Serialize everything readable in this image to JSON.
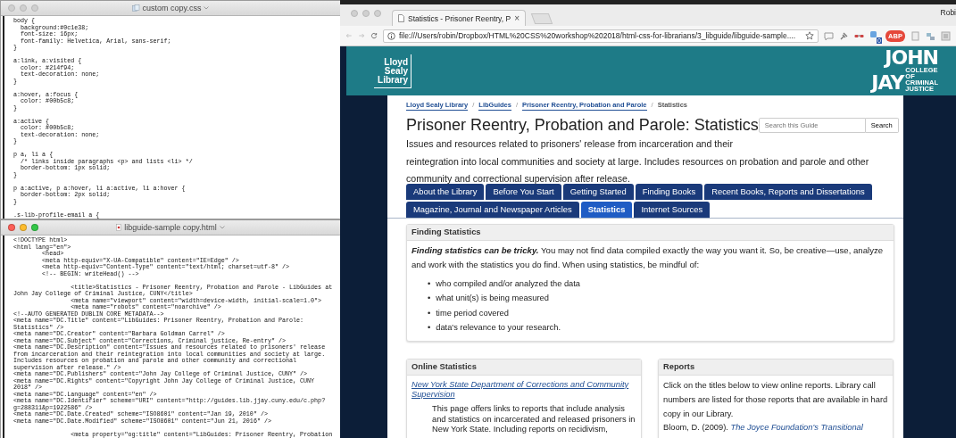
{
  "editors": [
    {
      "title": "custom copy.css",
      "active": false,
      "blocks": [
        [
          "body {",
          "  background:#0c1e38;",
          "  font-size: 16px;",
          "  font-family: Helvetica, Arial, sans-serif;",
          "}"
        ],
        [
          "a:link, a:visited {",
          "  color: #214f94;",
          "  text-decoration: none;",
          "}"
        ],
        [
          "a:hover, a:focus {",
          "  color: #00b5c8;",
          "}"
        ],
        [
          "a:active {",
          "  color: #00b5c8;",
          "  text-decoration: none;",
          "}"
        ],
        [
          "p a, li a {",
          "  /* links inside paragraphs <p> and lists <li> */",
          "  border-bottom: 1px solid;",
          "}"
        ],
        [
          "p a:active, p a:hover, li a:active, li a:hover {",
          "  border-bottom: 2px solid;",
          "}"
        ],
        [
          ".s-lib-profile-email a {"
        ]
      ]
    },
    {
      "title": "libguide-sample copy.html",
      "active": true,
      "blocks": [
        [
          "<!DOCTYPE html>",
          "<html lang=\"en\">",
          "        <head>",
          "        <meta http-equiv=\"X-UA-Compatible\" content=\"IE=Edge\" />",
          "        <meta http-equiv=\"Content-Type\" content=\"text/html; charset=utf-8\" />",
          "        <!-- BEGIN: writeHead() -->"
        ],
        [
          "                <title>Statistics - Prisoner Reentry, Probation and Parole - LibGuides at",
          "John Jay College of Criminal Justice, CUNY</title>",
          "                <meta name=\"viewport\" content=\"width=device-width, initial-scale=1.0\">",
          "                <meta name=\"robots\" content=\"noarchive\" />",
          "<!--AUTO GENERATED DUBLIN CORE METADATA-->",
          "<meta name=\"DC.Title\" content=\"LibGuides: Prisoner Reentry, Probation and Parole:",
          "Statistics\" />",
          "<meta name=\"DC.Creator\" content=\"Barbara Goldman Carrel\" />",
          "<meta name=\"DC.Subject\" content=\"Corrections, Criminal justice, Re-entry\" />",
          "<meta name=\"DC.Description\" content=\"Issues and resources related to prisoners' release",
          "from incarceration and their reintegration into local communities and society at large.",
          "Includes resources on probation and parole and other community and correctional",
          "supervision after release.\" />",
          "<meta name=\"DC.Publishers\" content=\"John Jay College of Criminal Justice, CUNY\" />",
          "<meta name=\"DC.Rights\" content=\"Copyright John Jay College of Criminal Justice, CUNY",
          "2018\" />",
          "<meta name=\"DC.Language\" content=\"en\" />",
          "<meta name=\"DC.Identifier\" scheme=\"URI\" content=\"http://guides.lib.jjay.cuny.edu/c.php?",
          "g=288311&p=1922586\" />",
          "<meta name=\"DC.Date.Created\" scheme=\"ISO8601\" content=\"Jan 19, 2010\" />",
          "<meta name=\"DC.Date.Modified\" scheme=\"ISO8601\" content=\"Jun 21, 2016\" />"
        ],
        [
          "                <meta property=\"og:title\" content=\"LibGuides: Prisoner Reentry, Probation"
        ]
      ]
    }
  ],
  "browser": {
    "tab": {
      "title": "Statistics - Prisoner Reentry, P",
      "close": "×"
    },
    "profile": "Robi",
    "url": "file:///Users/robin/Dropbox/HTML%20CSS%20workshop%202018/html-css-for-librarians/3_libguide/libguide-sample....",
    "extensions": [
      {
        "kind": "bubble"
      },
      {
        "kind": "pin"
      },
      {
        "kind": "glasses"
      },
      {
        "kind": "badge",
        "label": "0"
      },
      {
        "kind": "stop",
        "label": "ABP"
      },
      {
        "kind": "page"
      },
      {
        "kind": "satellite"
      },
      {
        "kind": "panel"
      }
    ]
  },
  "page": {
    "header": {
      "library_logo": [
        "Lloyd",
        "Sealy",
        "Library"
      ],
      "college_logo": {
        "name": [
          "JOHN",
          "JAY"
        ],
        "tagline": [
          "COLLEGE",
          "OF",
          "CRIMINAL",
          "JUSTICE"
        ]
      }
    },
    "breadcrumbs": {
      "separator": "/",
      "items": [
        {
          "label": "Lloyd Sealy Library",
          "link": true
        },
        {
          "label": "LibGuides",
          "link": true
        },
        {
          "label": "Prisoner Reentry, Probation and Parole",
          "link": true
        },
        {
          "label": "Statistics",
          "link": false
        }
      ]
    },
    "title": "Prisoner Reentry, Probation and Parole: Statistics",
    "search": {
      "placeholder": "Search this Guide",
      "button": "Search"
    },
    "description": [
      "Issues and resources related to prisoners' release from incarceration and their",
      "reintegration into local communities and society at large. Includes resources on probation and parole and other community and correctional supervision after release."
    ],
    "tabs": [
      {
        "label": "About the Library",
        "selected": false
      },
      {
        "label": "Before You Start",
        "selected": false
      },
      {
        "label": "Getting Started",
        "selected": false
      },
      {
        "label": "Finding Books",
        "selected": false
      },
      {
        "label": "Recent Books, Reports and Dissertations",
        "selected": false
      },
      {
        "label": "Magazine, Journal and Newspaper Articles",
        "selected": false
      },
      {
        "label": "Statistics",
        "selected": true
      },
      {
        "label": "Internet Sources",
        "selected": false
      }
    ],
    "finding": {
      "heading": "Finding Statistics",
      "intro": "**Finding statistics can be tricky.**  You may not find data compiled exactly the way you want it.  So, be creative—use, analyze and work with the statistics you do find.  When using statistics, be mindful of:",
      "bullet": "•",
      "bullets": [
        "who compiled and/or analyzed the data",
        "what unit(s) is being measured",
        "time period covered",
        "data's relevance to your research."
      ]
    },
    "online": {
      "heading": "Online Statistics",
      "link": "New York State Department of Corrections and Community Supervision",
      "text": "This page offers links to reports that include analysis and statistics on incarcerated and released prisoners in New York State. Including reports on recidivism,"
    },
    "reports": {
      "heading": "Reports",
      "text": "Click on the titles below to view online reports.  Library call numbers are listed for those reports that are available in hard copy in our Library.",
      "citation": "Bloom, D. (2009).",
      "citation_link": "The Joyce Foundation's Transitional"
    }
  }
}
